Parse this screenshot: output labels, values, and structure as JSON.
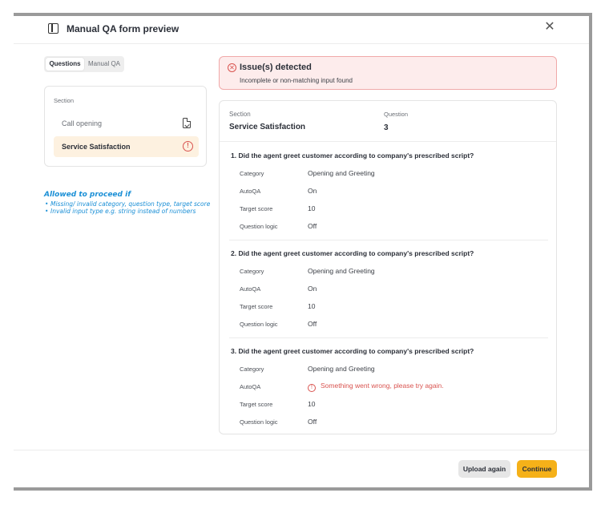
{
  "header": {
    "title": "Manual QA form preview"
  },
  "tabs": [
    {
      "label": "Questions"
    },
    {
      "label": "Manual QA"
    }
  ],
  "sidebar": {
    "label": "Section",
    "items": [
      {
        "label": "Call opening"
      },
      {
        "label": "Service Satisfaction"
      }
    ]
  },
  "note": {
    "heading": "Allowed to proceed if",
    "bullets": [
      "Missing/ invalid category, question type, target score",
      "Invalid input type e.g. string instead of numbers"
    ]
  },
  "alert": {
    "title": "Issue(s) detected",
    "message": "Incomplete or non-matching input found"
  },
  "summary": {
    "section_label": "Section",
    "section_value": "Service Satisfaction",
    "question_label": "Question",
    "question_value": "3"
  },
  "field_labels": {
    "category": "Category",
    "autoqa": "AutoQA",
    "target_score": "Target score",
    "question_logic": "Question logic"
  },
  "questions": [
    {
      "title": "1. Did the agent greet customer according to company's prescribed script?",
      "category": "Opening and Greeting",
      "autoqa": "On",
      "target_score": "10",
      "question_logic": "Off"
    },
    {
      "title": "2. Did the agent greet customer according to company's prescribed script?",
      "category": "Opening and Greeting",
      "autoqa": "On",
      "target_score": "10",
      "question_logic": "Off"
    },
    {
      "title": "3. Did the agent greet customer according to company's prescribed script?",
      "category": "Opening and Greeting",
      "autoqa": "Something went wrong, please try again.",
      "target_score": "10",
      "question_logic": "Off"
    }
  ],
  "footer": {
    "upload_label": "Upload again",
    "continue_label": "Continue"
  },
  "colors": {
    "accent": "#f5b119",
    "error": "#d9534f",
    "selected_bg": "#fdf1e0",
    "annotation": "#1a8fd6"
  }
}
